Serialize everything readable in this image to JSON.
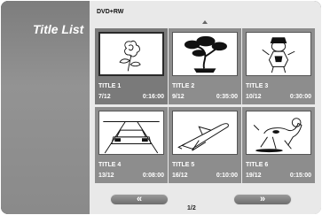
{
  "sidebar": {
    "title": "Title List"
  },
  "main": {
    "disc_type": "DVD+RW",
    "titles": [
      {
        "name": "TITLE 1",
        "date": "7/12",
        "duration": "0:16:00",
        "thumbnail": "rose-icon",
        "selected": true
      },
      {
        "name": "TITLE 2",
        "date": "9/12",
        "duration": "0:35:00",
        "thumbnail": "bonsai-tree-icon"
      },
      {
        "name": "TITLE 3",
        "date": "10/12",
        "duration": "0:30:00",
        "thumbnail": "cartoon-character-icon"
      },
      {
        "name": "TITLE 4",
        "date": "13/12",
        "duration": "0:08:00",
        "thumbnail": "car-on-road-icon"
      },
      {
        "name": "TITLE 5",
        "date": "16/12",
        "duration": "0:10:00",
        "thumbnail": "space-shuttle-icon"
      },
      {
        "name": "TITLE 6",
        "date": "19/12",
        "duration": "0:15:00",
        "thumbnail": "dog-icon"
      }
    ]
  },
  "pagination": {
    "prev_label": "«",
    "next_label": "»",
    "page": "1/2"
  }
}
